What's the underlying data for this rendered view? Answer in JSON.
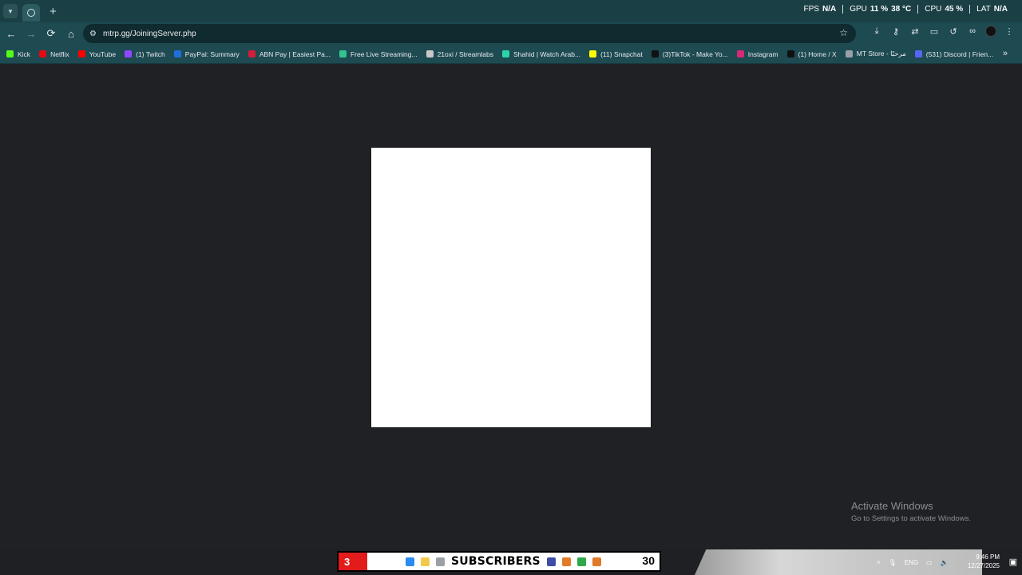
{
  "browser": {
    "tab_list_icon": "chevron-down-icon",
    "new_tab_icon": "plus-icon",
    "overlay": {
      "fps_label": "FPS",
      "fps_value": "N/A",
      "gpu_label": "GPU",
      "gpu_value": "11 %",
      "gpu_temp": "38 °C",
      "cpu_label": "CPU",
      "cpu_value": "45 %",
      "lat_label": "LAT",
      "lat_value": "N/A"
    },
    "toolbar": {
      "back": "←",
      "forward": "→",
      "reload": "⟳",
      "home": "⌂",
      "site_info": "⚙",
      "url": "mtrp.gg/JoiningServer.php",
      "star": "☆",
      "more": "⋮"
    },
    "bookmarks": [
      {
        "label": "Kick",
        "color": "#53fc18"
      },
      {
        "label": "Netflix",
        "color": "#e50914"
      },
      {
        "label": "YouTube",
        "color": "#ff0000"
      },
      {
        "label": "(1) Twitch",
        "color": "#9146ff"
      },
      {
        "label": "PayPal: Summary",
        "color": "#1e6fd9"
      },
      {
        "label": "ABN Pay | Easiest Pa...",
        "color": "#d11f3b"
      },
      {
        "label": "Free Live Streaming...",
        "color": "#31c48d"
      },
      {
        "label": "21oxi / Streamlabs",
        "color": "#c8c8c8"
      },
      {
        "label": "Shahid | Watch Arab...",
        "color": "#2bd4a8"
      },
      {
        "label": "(11) Snapchat",
        "color": "#fffc00"
      },
      {
        "label": "(3)TikTok - Make Yo...",
        "color": "#111111"
      },
      {
        "label": "Instagram",
        "color": "#d62976"
      },
      {
        "label": "(1) Home / X",
        "color": "#111111"
      },
      {
        "label": "MT Store - مرحبًا",
        "color": "#9aa0a6"
      },
      {
        "label": "(531) Discord | Frien...",
        "color": "#5865f2"
      }
    ],
    "bookmarks_more": "»"
  },
  "watermark": {
    "title": "Activate Windows",
    "subtitle": "Go to Settings to activate Windows."
  },
  "taskbar": {
    "subscribers_count": "3",
    "subscribers_label": "SUBSCRIBERS",
    "subscribers_goal": "30",
    "tray": {
      "language": "ENG",
      "time": "9:46 PM",
      "date": "12/27/2025"
    }
  }
}
